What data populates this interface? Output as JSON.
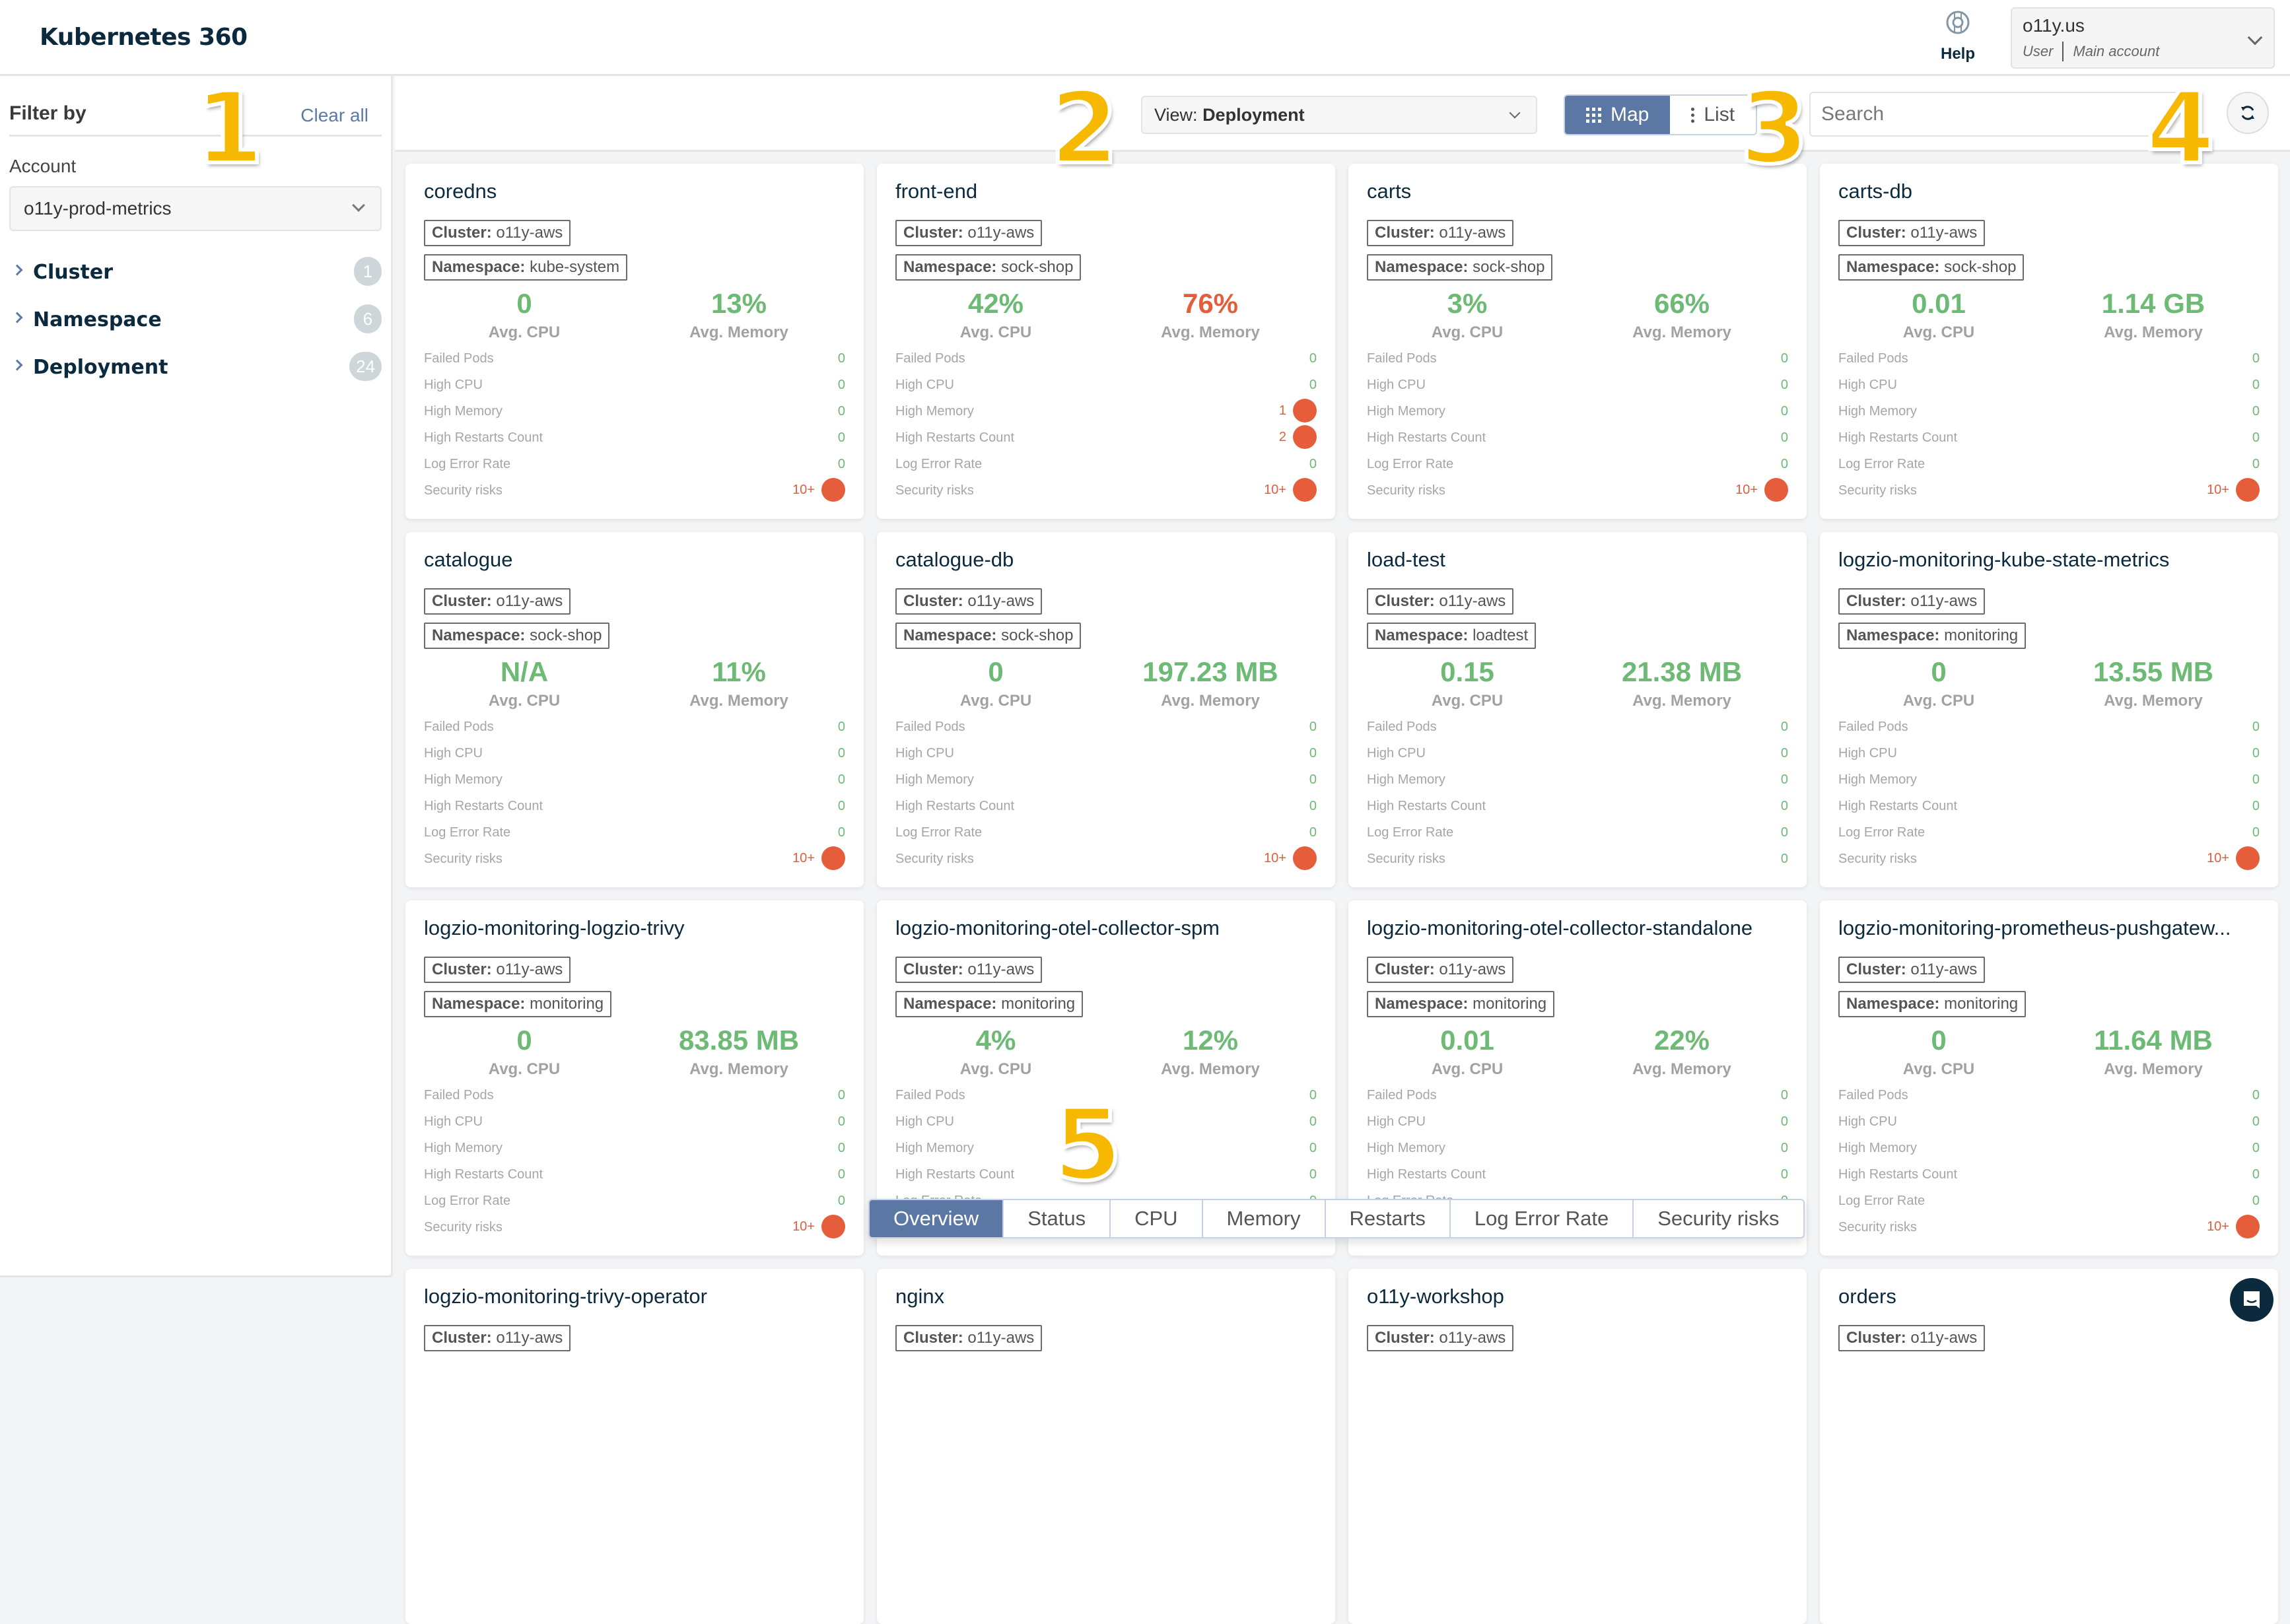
{
  "header": {
    "title": "Kubernetes 360",
    "help_label": "Help",
    "account": {
      "name": "o11y.us",
      "role": "User",
      "account_type": "Main account"
    }
  },
  "sidebar": {
    "title": "Filter by",
    "clear_all": "Clear all",
    "account_label": "Account",
    "account_value": "o11y-prod-metrics",
    "facets": [
      {
        "label": "Cluster",
        "count": "1"
      },
      {
        "label": "Namespace",
        "count": "6"
      },
      {
        "label": "Deployment",
        "count": "24"
      }
    ]
  },
  "toolbar": {
    "view_prefix": "View:",
    "view_value": "Deployment",
    "map_label": "Map",
    "list_label": "List",
    "search_placeholder": "Search",
    "search_value": ""
  },
  "labels": {
    "cluster": "Cluster:",
    "namespace": "Namespace:",
    "avg_cpu": "Avg. CPU",
    "avg_memory": "Avg. Memory",
    "failed_pods": "Failed Pods",
    "high_cpu": "High CPU",
    "high_memory": "High Memory",
    "high_restarts": "High Restarts Count",
    "log_error_rate": "Log Error Rate",
    "security_risks": "Security risks"
  },
  "colors": {
    "ok": "#6dba75",
    "alert": "#e55d3b",
    "accent": "#5b78a5",
    "navy": "#0c2a3e"
  },
  "cards": [
    {
      "name": "coredns",
      "cluster": "o11y-aws",
      "namespace": "kube-system",
      "cpu": "0",
      "memory": "13%",
      "memory_alert": false,
      "failed_pods": "0",
      "high_cpu": "0",
      "high_memory": "0",
      "high_restarts": "0",
      "log_error_rate": "0",
      "security_risks": "10+"
    },
    {
      "name": "front-end",
      "cluster": "o11y-aws",
      "namespace": "sock-shop",
      "cpu": "42%",
      "memory": "76%",
      "memory_alert": true,
      "failed_pods": "0",
      "high_cpu": "0",
      "high_memory": "1",
      "high_restarts": "2",
      "log_error_rate": "0",
      "security_risks": "10+"
    },
    {
      "name": "carts",
      "cluster": "o11y-aws",
      "namespace": "sock-shop",
      "cpu": "3%",
      "memory": "66%",
      "memory_alert": false,
      "failed_pods": "0",
      "high_cpu": "0",
      "high_memory": "0",
      "high_restarts": "0",
      "log_error_rate": "0",
      "security_risks": "10+"
    },
    {
      "name": "carts-db",
      "cluster": "o11y-aws",
      "namespace": "sock-shop",
      "cpu": "0.01",
      "memory": "1.14 GB",
      "memory_alert": false,
      "failed_pods": "0",
      "high_cpu": "0",
      "high_memory": "0",
      "high_restarts": "0",
      "log_error_rate": "0",
      "security_risks": "10+"
    },
    {
      "name": "catalogue",
      "cluster": "o11y-aws",
      "namespace": "sock-shop",
      "cpu": "N/A",
      "memory": "11%",
      "memory_alert": false,
      "failed_pods": "0",
      "high_cpu": "0",
      "high_memory": "0",
      "high_restarts": "0",
      "log_error_rate": "0",
      "security_risks": "10+"
    },
    {
      "name": "catalogue-db",
      "cluster": "o11y-aws",
      "namespace": "sock-shop",
      "cpu": "0",
      "memory": "197.23 MB",
      "memory_alert": false,
      "failed_pods": "0",
      "high_cpu": "0",
      "high_memory": "0",
      "high_restarts": "0",
      "log_error_rate": "0",
      "security_risks": "10+"
    },
    {
      "name": "load-test",
      "cluster": "o11y-aws",
      "namespace": "loadtest",
      "cpu": "0.15",
      "memory": "21.38 MB",
      "memory_alert": false,
      "failed_pods": "0",
      "high_cpu": "0",
      "high_memory": "0",
      "high_restarts": "0",
      "log_error_rate": "0",
      "security_risks": "0"
    },
    {
      "name": "logzio-monitoring-kube-state-metrics",
      "cluster": "o11y-aws",
      "namespace": "monitoring",
      "cpu": "0",
      "memory": "13.55 MB",
      "memory_alert": false,
      "failed_pods": "0",
      "high_cpu": "0",
      "high_memory": "0",
      "high_restarts": "0",
      "log_error_rate": "0",
      "security_risks": "10+"
    },
    {
      "name": "logzio-monitoring-logzio-trivy",
      "cluster": "o11y-aws",
      "namespace": "monitoring",
      "cpu": "0",
      "memory": "83.85 MB",
      "memory_alert": false,
      "failed_pods": "0",
      "high_cpu": "0",
      "high_memory": "0",
      "high_restarts": "0",
      "log_error_rate": "0",
      "security_risks": "10+"
    },
    {
      "name": "logzio-monitoring-otel-collector-spm",
      "cluster": "o11y-aws",
      "namespace": "monitoring",
      "cpu": "4%",
      "memory": "12%",
      "memory_alert": false,
      "failed_pods": "0",
      "high_cpu": "0",
      "high_memory": "0",
      "high_restarts": "0",
      "log_error_rate": "0",
      "security_risks": ""
    },
    {
      "name": "logzio-monitoring-otel-collector-standalone",
      "cluster": "o11y-aws",
      "namespace": "monitoring",
      "cpu": "0.01",
      "memory": "22%",
      "memory_alert": false,
      "failed_pods": "0",
      "high_cpu": "0",
      "high_memory": "0",
      "high_restarts": "0",
      "log_error_rate": "0",
      "security_risks": ""
    },
    {
      "name": "logzio-monitoring-prometheus-pushgatew...",
      "cluster": "o11y-aws",
      "namespace": "monitoring",
      "cpu": "0",
      "memory": "11.64 MB",
      "memory_alert": false,
      "failed_pods": "0",
      "high_cpu": "0",
      "high_memory": "0",
      "high_restarts": "0",
      "log_error_rate": "0",
      "security_risks": "10+"
    },
    {
      "name": "logzio-monitoring-trivy-operator",
      "cluster": "o11y-aws",
      "partial": true
    },
    {
      "name": "nginx",
      "cluster": "o11y-aws",
      "partial": true
    },
    {
      "name": "o11y-workshop",
      "cluster": "o11y-aws",
      "partial": true
    },
    {
      "name": "orders",
      "cluster": "o11y-aws",
      "partial": true
    }
  ],
  "bottom_tabs": [
    {
      "label": "Overview",
      "active": true
    },
    {
      "label": "Status",
      "active": false
    },
    {
      "label": "CPU",
      "active": false
    },
    {
      "label": "Memory",
      "active": false
    },
    {
      "label": "Restarts",
      "active": false
    },
    {
      "label": "Log Error Rate",
      "active": false
    },
    {
      "label": "Security risks",
      "active": false
    }
  ],
  "annotations": [
    "1",
    "2",
    "3",
    "4",
    "5"
  ]
}
